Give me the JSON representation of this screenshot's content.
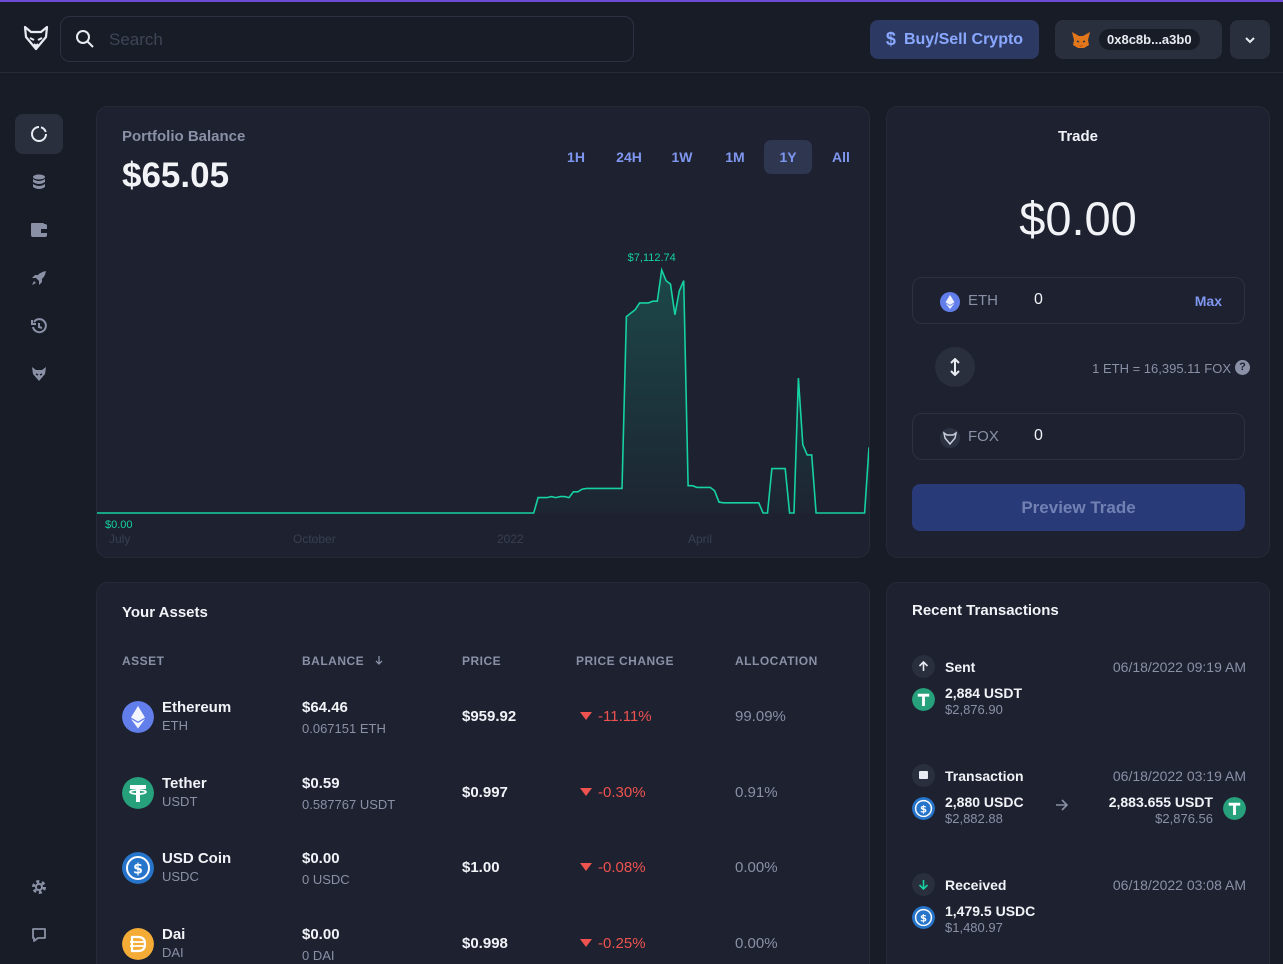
{
  "header": {
    "search_placeholder": "Search",
    "buy_sell_label": "Buy/Sell Crypto",
    "buy_sell_icon": "$",
    "wallet_address": "0x8c8b...a3b0"
  },
  "sidebar": {
    "items": [
      {
        "name": "dashboard",
        "icon": "dashboard-icon",
        "active": true
      },
      {
        "name": "assets",
        "icon": "coins-icon"
      },
      {
        "name": "accounts",
        "icon": "wallet-icon"
      },
      {
        "name": "defi",
        "icon": "rocket-icon"
      },
      {
        "name": "history",
        "icon": "history-icon"
      },
      {
        "name": "fox",
        "icon": "fox-icon"
      }
    ],
    "bottom": [
      {
        "name": "settings",
        "icon": "gear-icon"
      },
      {
        "name": "feedback",
        "icon": "chat-icon"
      }
    ]
  },
  "portfolio": {
    "label": "Portfolio Balance",
    "value": "$65.05",
    "ranges": [
      "1H",
      "24H",
      "1W",
      "1M",
      "1Y",
      "All"
    ],
    "active_range": "1Y"
  },
  "chart_data": {
    "type": "area",
    "x_labels": [
      "July",
      "October",
      "2022",
      "April"
    ],
    "values": [
      0,
      0,
      0,
      0,
      0,
      0,
      0,
      0,
      0,
      0,
      0,
      0,
      0,
      0,
      0,
      0,
      0,
      0,
      0,
      0,
      0,
      0,
      0,
      0,
      0,
      0,
      0,
      0,
      0,
      0,
      0,
      0,
      0,
      0,
      0,
      0,
      0,
      0,
      0,
      0,
      0,
      0,
      0,
      0,
      0,
      0,
      0,
      0,
      0,
      0,
      0,
      0,
      0,
      0,
      0,
      0,
      0,
      0,
      0,
      0,
      0,
      0,
      0,
      0,
      0,
      0,
      0,
      0,
      0,
      0,
      0,
      0,
      0,
      0,
      0,
      0,
      0,
      0,
      0,
      0,
      0,
      0,
      0,
      0,
      0,
      0,
      0,
      0,
      0,
      0,
      0,
      0,
      0,
      0,
      0,
      0,
      0,
      0,
      0,
      0,
      450,
      450,
      450,
      480,
      450,
      480,
      480,
      450,
      620,
      620,
      700,
      720,
      720,
      720,
      720,
      720,
      720,
      720,
      720,
      720,
      5750,
      5850,
      5950,
      6150,
      6150,
      6150,
      6200,
      6200,
      7112.74,
      6800,
      6700,
      5800,
      6500,
      6800,
      800,
      800,
      750,
      750,
      750,
      750,
      650,
      320,
      300,
      300,
      300,
      300,
      300,
      300,
      300,
      300,
      300,
      0,
      0,
      1300,
      1300,
      1300,
      1300,
      0,
      0,
      3950,
      2000,
      1700,
      1700,
      0,
      0,
      0,
      0,
      0,
      0,
      0,
      0,
      0,
      0,
      0,
      0,
      1920
    ],
    "max_label": "$7,112.74",
    "min_label": "$0.00",
    "ylim": [
      0,
      7112.74
    ],
    "color": "#16d1a1"
  },
  "trade": {
    "title": "Trade",
    "amount": "$0.00",
    "from": {
      "symbol": "ETH",
      "value": "0",
      "max_label": "Max"
    },
    "rate": "1 ETH = 16,395.11 FOX",
    "help": "?",
    "to": {
      "symbol": "FOX",
      "value": "0"
    },
    "preview_label": "Preview Trade"
  },
  "assets": {
    "title": "Your Assets",
    "columns": [
      "ASSET",
      "BALANCE",
      "PRICE",
      "PRICE CHANGE",
      "ALLOCATION"
    ],
    "rows": [
      {
        "name": "Ethereum",
        "symbol": "ETH",
        "balance_usd": "$64.46",
        "balance": "0.067151 ETH",
        "price": "$959.92",
        "change": "-11.11%",
        "allocation": "99.09%",
        "icon": "ethereum-icon",
        "color": "#627eea"
      },
      {
        "name": "Tether",
        "symbol": "USDT",
        "balance_usd": "$0.59",
        "balance": "0.587767 USDT",
        "price": "$0.997",
        "change": "-0.30%",
        "allocation": "0.91%",
        "icon": "tether-icon",
        "color": "#26a17b"
      },
      {
        "name": "USD Coin",
        "symbol": "USDC",
        "balance_usd": "$0.00",
        "balance": "0 USDC",
        "price": "$1.00",
        "change": "-0.08%",
        "allocation": "0.00%",
        "icon": "usdc-icon",
        "color": "#2775ca"
      },
      {
        "name": "Dai",
        "symbol": "DAI",
        "balance_usd": "$0.00",
        "balance": "0 DAI",
        "price": "$0.998",
        "change": "-0.25%",
        "allocation": "0.00%",
        "icon": "dai-icon",
        "color": "#f5ac37"
      }
    ]
  },
  "transactions": {
    "title": "Recent Transactions",
    "items": [
      {
        "type": "Sent",
        "date": "06/18/2022 09:19 AM",
        "amount": "2,884 USDT",
        "usd": "$2,876.90",
        "icon": "arrow-up-icon"
      },
      {
        "type": "Transaction",
        "date": "06/18/2022 03:19 AM",
        "amount": "2,880 USDC",
        "usd": "$2,882.88",
        "amount2": "2,883.655 USDT",
        "usd2": "$2,876.56",
        "icon": "square-icon"
      },
      {
        "type": "Received",
        "date": "06/18/2022 03:08 AM",
        "amount": "1,479.5 USDC",
        "usd": "$1,480.97",
        "icon": "arrow-down-icon"
      }
    ]
  }
}
